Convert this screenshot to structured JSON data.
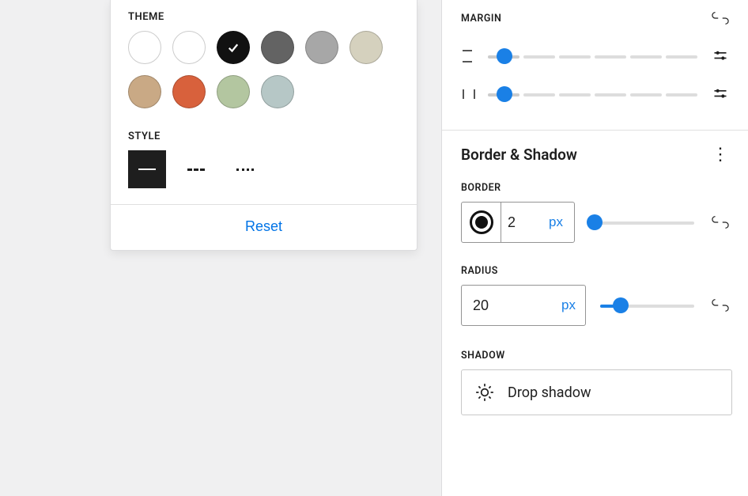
{
  "popup": {
    "theme_label": "THEME",
    "style_label": "STYLE",
    "reset_label": "Reset",
    "theme_colors": [
      {
        "hex": "#ffffff",
        "light": true,
        "selected": false,
        "name": "white"
      },
      {
        "hex": "#ffffff",
        "light": true,
        "selected": false,
        "name": "white-alt"
      },
      {
        "hex": "#111111",
        "light": false,
        "selected": true,
        "name": "black"
      },
      {
        "hex": "#636363",
        "light": false,
        "selected": false,
        "name": "dark-grey"
      },
      {
        "hex": "#a7a7a7",
        "light": false,
        "selected": false,
        "name": "grey"
      },
      {
        "hex": "#d5d1be",
        "light": false,
        "selected": false,
        "name": "beige"
      },
      {
        "hex": "#c9a985",
        "light": false,
        "selected": false,
        "name": "tan"
      },
      {
        "hex": "#d8613c",
        "light": false,
        "selected": false,
        "name": "orange"
      },
      {
        "hex": "#b3c6a0",
        "light": false,
        "selected": false,
        "name": "sage"
      },
      {
        "hex": "#b6c7c6",
        "light": false,
        "selected": false,
        "name": "slate"
      }
    ],
    "styles": [
      {
        "kind": "solid",
        "selected": true
      },
      {
        "kind": "dashed",
        "selected": false
      },
      {
        "kind": "dotted",
        "selected": false
      }
    ]
  },
  "sidebar": {
    "margin_label": "MARGIN",
    "panel_title": "Border & Shadow",
    "border_label": "BORDER",
    "border_value": "2",
    "border_unit": "px",
    "border_slider_pct": 5,
    "radius_label": "RADIUS",
    "radius_value": "20",
    "radius_unit": "px",
    "radius_slider_pct": 22,
    "shadow_label": "SHADOW",
    "shadow_button": "Drop shadow"
  }
}
